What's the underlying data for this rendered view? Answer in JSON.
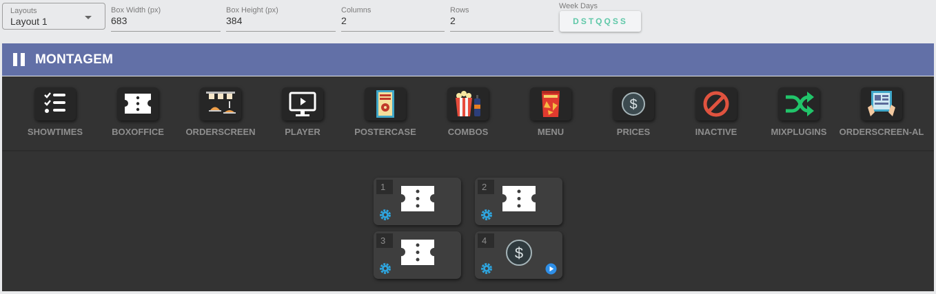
{
  "form": {
    "layouts": {
      "label": "Layouts",
      "value": "Layout 1"
    },
    "box_width": {
      "label": "Box Width (px)",
      "value": "683"
    },
    "box_height": {
      "label": "Box Height (px)",
      "value": "384"
    },
    "columns": {
      "label": "Columns",
      "value": "2"
    },
    "rows": {
      "label": "Rows",
      "value": "2"
    },
    "week_days": {
      "label": "Week Days",
      "value": "DSTQQSS"
    }
  },
  "header": {
    "title": "MONTAGEM",
    "icon": "pause-icon",
    "color": "#6270a7"
  },
  "toolbar": {
    "items": [
      {
        "label": "SHOWTIMES",
        "icon": "checklist-icon"
      },
      {
        "label": "BOXOFFICE",
        "icon": "ticket-icon"
      },
      {
        "label": "ORDERSCREEN",
        "icon": "kitchen-order-icon"
      },
      {
        "label": "PLAYER",
        "icon": "monitor-play-icon"
      },
      {
        "label": "POSTERCASE",
        "icon": "poster-icon"
      },
      {
        "label": "COMBOS",
        "icon": "popcorn-combo-icon"
      },
      {
        "label": "MENU",
        "icon": "snack-bag-icon"
      },
      {
        "label": "PRICES",
        "icon": "dollar-icon"
      },
      {
        "label": "INACTIVE",
        "icon": "prohibited-icon"
      },
      {
        "label": "MIXPLUGINS",
        "icon": "shuffle-icon"
      },
      {
        "label": "ORDERSCREEN-AL",
        "icon": "touch-screen-icon"
      }
    ]
  },
  "montage": {
    "cells": [
      {
        "number": "1",
        "plugin": "ticket-icon"
      },
      {
        "number": "2",
        "plugin": "ticket-icon"
      },
      {
        "number": "3",
        "plugin": "ticket-icon"
      },
      {
        "number": "4",
        "plugin": "dollar-icon",
        "playing": true
      }
    ]
  },
  "colors": {
    "accent_gear": "#2ea6e0",
    "week_days_text": "#5fc8a8",
    "panel_bg": "#333333"
  }
}
